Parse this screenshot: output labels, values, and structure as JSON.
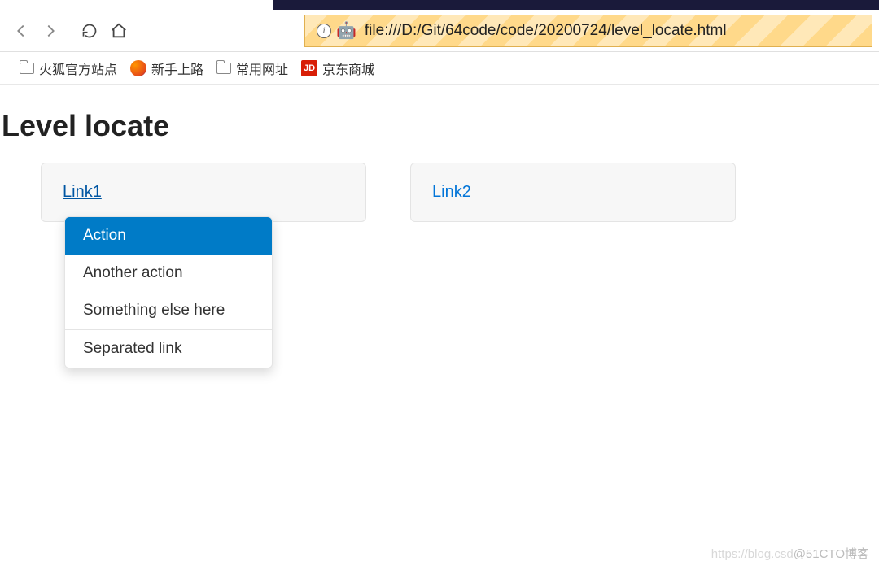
{
  "browser": {
    "url": "file:///D:/Git/64code/code/20200724/level_locate.html",
    "info_glyph": "i",
    "robot_glyph": "🤖"
  },
  "bookmarks": {
    "items": [
      {
        "label": "火狐官方站点",
        "icon": "folder"
      },
      {
        "label": "新手上路",
        "icon": "firefox"
      },
      {
        "label": "常用网址",
        "icon": "folder"
      },
      {
        "label": "京东商城",
        "icon": "jd",
        "badge": "JD"
      }
    ]
  },
  "page": {
    "heading": "Level locate",
    "panels": [
      {
        "link_label": "Link1",
        "has_dropdown": true
      },
      {
        "link_label": "Link2",
        "has_dropdown": false
      }
    ]
  },
  "dropdown": {
    "items": [
      {
        "label": "Action",
        "highlighted": true
      },
      {
        "label": "Another action",
        "highlighted": false
      },
      {
        "label": "Something else here",
        "highlighted": false
      }
    ],
    "separated_label": "Separated link"
  },
  "watermark": {
    "faint": "https://blog.csd",
    "dark": "@51CTO博客"
  }
}
